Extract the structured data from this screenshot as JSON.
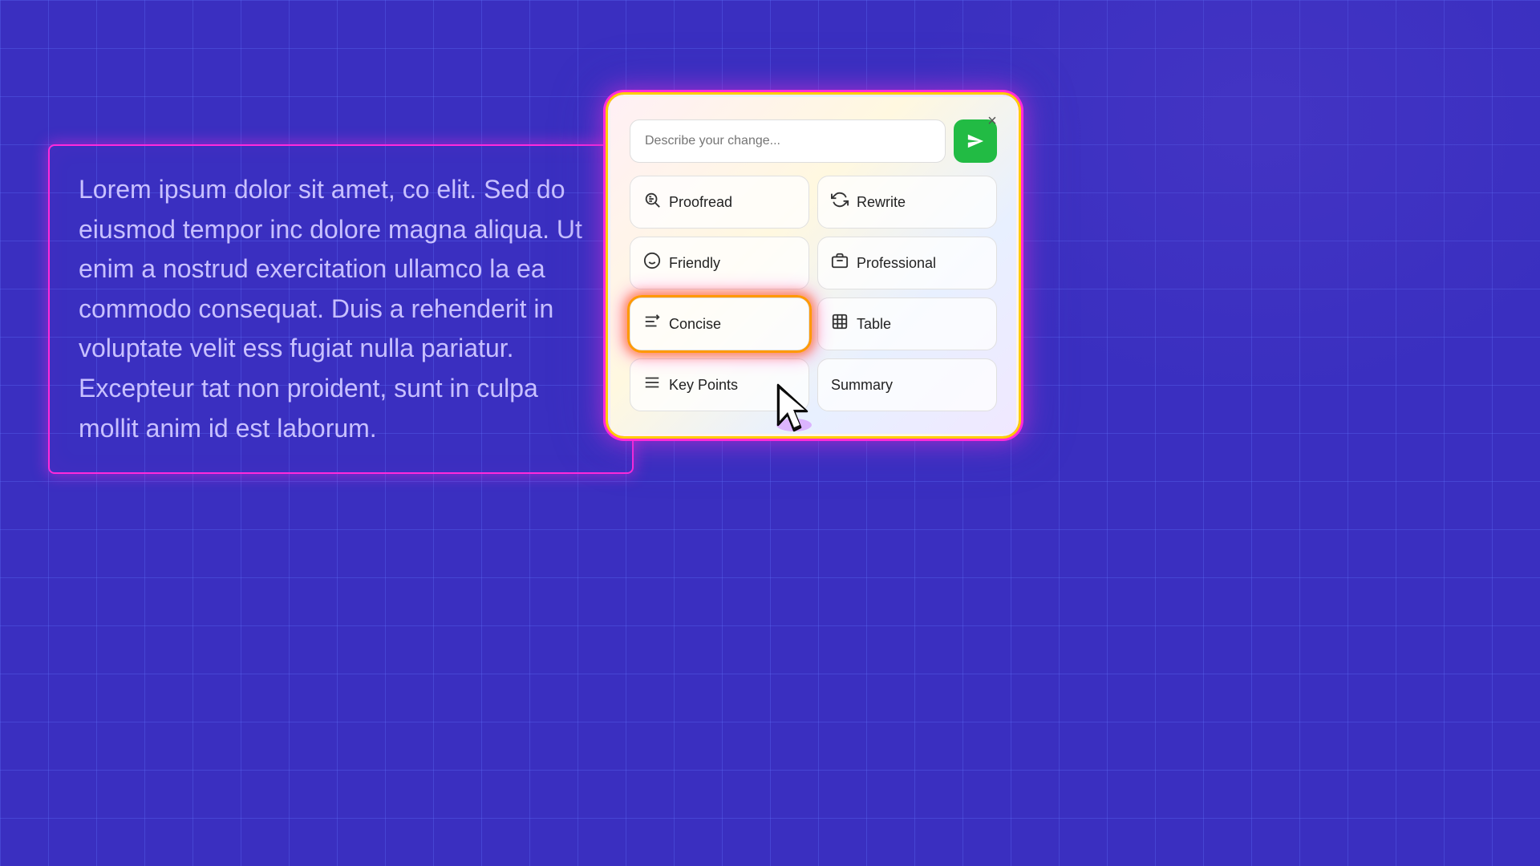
{
  "background": {
    "color": "#3a2fc0"
  },
  "text_box": {
    "content": "Lorem ipsum dolor sit amet, co elit. Sed do eiusmod tempor inc dolore magna aliqua. Ut enim a nostrud exercitation ullamco la ea commodo consequat. Duis a rehenderit in voluptate velit ess fugiat nulla pariatur. Excepteur tat non proident, sunt in culpa mollit anim id est laborum."
  },
  "ai_panel": {
    "close_label": "×",
    "search_placeholder": "Describe your change...",
    "send_label": "Send",
    "buttons": [
      {
        "id": "proofread",
        "icon": "🔍",
        "label": "Proofread"
      },
      {
        "id": "rewrite",
        "icon": "↻",
        "label": "Rewrite"
      },
      {
        "id": "friendly",
        "icon": "😊",
        "label": "Friendly"
      },
      {
        "id": "professional",
        "icon": "💼",
        "label": "Professional"
      },
      {
        "id": "concise",
        "icon": "≡",
        "label": "Concise"
      },
      {
        "id": "table",
        "icon": "⊞",
        "label": "Table"
      },
      {
        "id": "key-points",
        "icon": "☰",
        "label": "Key Points"
      },
      {
        "id": "summary",
        "icon": "",
        "label": "Summary"
      }
    ]
  }
}
